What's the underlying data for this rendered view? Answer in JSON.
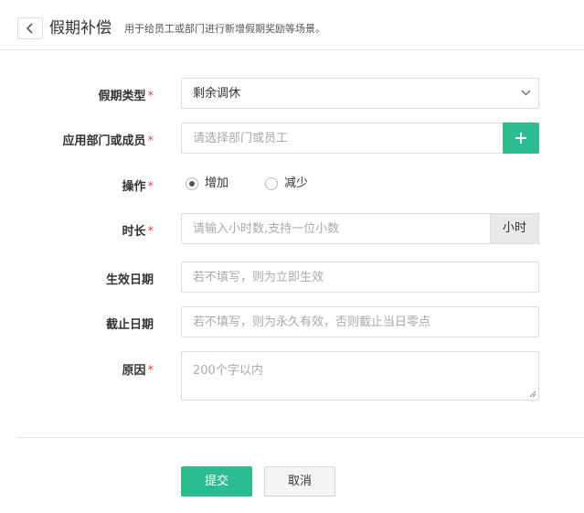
{
  "header": {
    "title": "假期补偿",
    "description": "用于给员工或部门进行新增假期奖励等场景。"
  },
  "form": {
    "leave_type": {
      "label": "假期类型",
      "required": "*",
      "value": "剩余调休"
    },
    "members": {
      "label": "应用部门或成员",
      "required": "*",
      "placeholder": "请选择部门或员工"
    },
    "operation": {
      "label": "操作",
      "required": "*",
      "options": [
        "增加",
        "减少"
      ],
      "selected": "增加"
    },
    "duration": {
      "label": "时长",
      "required": "*",
      "placeholder": "请输入小时数,支持一位小数",
      "unit": "小时"
    },
    "effective_date": {
      "label": "生效日期",
      "placeholder": "若不填写，则为立即生效"
    },
    "expiry_date": {
      "label": "截止日期",
      "placeholder": "若不填写，则为永久有效，否则截止当日零点"
    },
    "reason": {
      "label": "原因",
      "required": "*",
      "placeholder": "200个字以内"
    }
  },
  "actions": {
    "submit": "提交",
    "cancel": "取消"
  },
  "colors": {
    "primary": "#2bbd8f",
    "required": "#e5484d"
  }
}
